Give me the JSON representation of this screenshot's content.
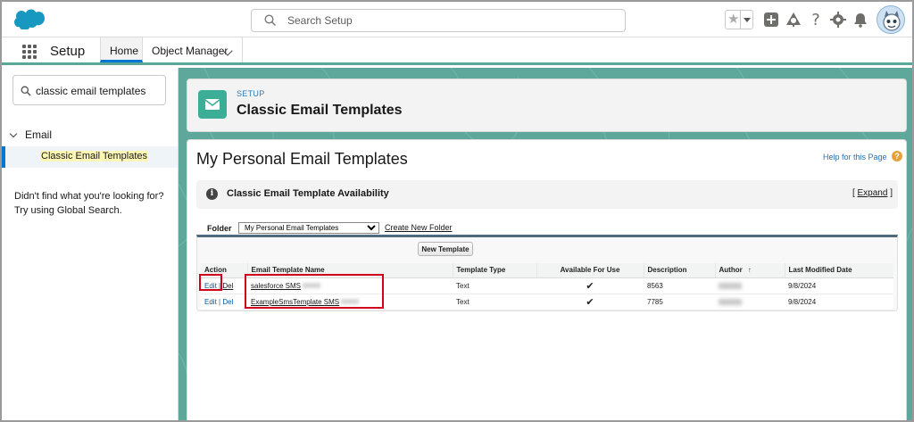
{
  "header": {
    "search_placeholder": "Search Setup",
    "icons": [
      "favorite-star-icon",
      "add-icon",
      "trailhead-icon",
      "help-icon",
      "settings-gear-icon",
      "notification-bell-icon",
      "user-avatar"
    ]
  },
  "nav": {
    "app_name": "Setup",
    "tabs": [
      {
        "label": "Home",
        "active": true
      },
      {
        "label": "Object Manager",
        "active": false
      }
    ]
  },
  "sidebar": {
    "search_value": "classic email templates",
    "group_label": "Email",
    "selected_item": "Classic Email Templates",
    "help_line1": "Didn't find what you're looking for?",
    "help_line2": "Try using Global Search."
  },
  "page_header": {
    "breadcrumb": "SETUP",
    "title": "Classic Email Templates"
  },
  "content": {
    "title": "My Personal Email Templates",
    "help_link": "Help for this Page",
    "availability_title": "Classic Email Template Availability",
    "expand_label": "Expand",
    "folder_label": "Folder",
    "folder_selected": "My Personal Email Templates",
    "create_folder_link": "Create New Folder",
    "new_template_button": "New Template"
  },
  "table": {
    "headers": {
      "action": "Action",
      "name": "Email Template Name",
      "type": "Template Type",
      "available": "Available For Use",
      "description": "Description",
      "author": "Author",
      "modified": "Last Modified Date"
    },
    "edit_label": "Edit",
    "sep": "|",
    "del_label": "Del",
    "check": "✔",
    "rows": [
      {
        "name": "salesforce SMS",
        "type": "Text",
        "available": true,
        "description": "8563",
        "modified": "9/8/2024"
      },
      {
        "name": "ExampleSmsTemplate SMS",
        "type": "Text",
        "available": true,
        "description": "7785",
        "modified": "9/8/2024"
      }
    ]
  },
  "colors": {
    "brand_blue": "#0176d3",
    "teal_bg": "#5ea89b",
    "highlight_red": "#d0021b",
    "email_icon_bg": "#3cae98"
  }
}
